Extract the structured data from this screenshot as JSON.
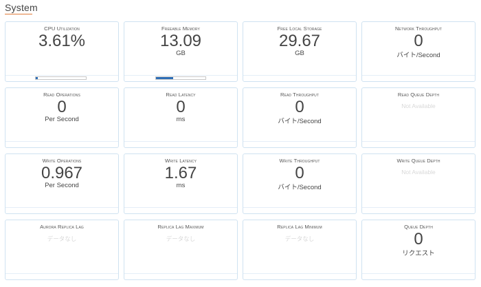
{
  "section": {
    "title": "System"
  },
  "colors": {
    "accent": "#e07b39",
    "card_border": "#cfe2f1",
    "progress_fill": "#2e6fb7",
    "muted_text": "#d8d8d8"
  },
  "metrics": [
    {
      "label": "CPU Utilization",
      "value": "3.61%",
      "unit": "",
      "progress_percent": 3.6
    },
    {
      "label": "Freeable Memory",
      "value": "13.09",
      "unit": "GB",
      "progress_percent": 35
    },
    {
      "label": "Free Local Storage",
      "value": "29.67",
      "unit": "GB"
    },
    {
      "label": "Network Throughput",
      "value": "0",
      "unit": "バイト/Second"
    },
    {
      "label": "Read Operations",
      "value": "0",
      "unit": "Per Second"
    },
    {
      "label": "Read Latency",
      "value": "0",
      "unit": "ms"
    },
    {
      "label": "Read Throughput",
      "value": "0",
      "unit": "バイト/Second"
    },
    {
      "label": "Read Queue Depth",
      "status": "Not Available"
    },
    {
      "label": "Write Operations",
      "value": "0.967",
      "unit": "Per Second"
    },
    {
      "label": "Write Latency",
      "value": "1.67",
      "unit": "ms"
    },
    {
      "label": "Write Throughput",
      "value": "0",
      "unit": "バイト/Second"
    },
    {
      "label": "Write Queue Depth",
      "status": "Not Available"
    },
    {
      "label": "Aurora Replica Lag",
      "status": "データなし"
    },
    {
      "label": "Replica Lag Maximum",
      "status": "データなし"
    },
    {
      "label": "Replica Lag Minimum",
      "status": "データなし"
    },
    {
      "label": "Queue Depth",
      "value": "0",
      "unit": "リクエスト"
    }
  ]
}
